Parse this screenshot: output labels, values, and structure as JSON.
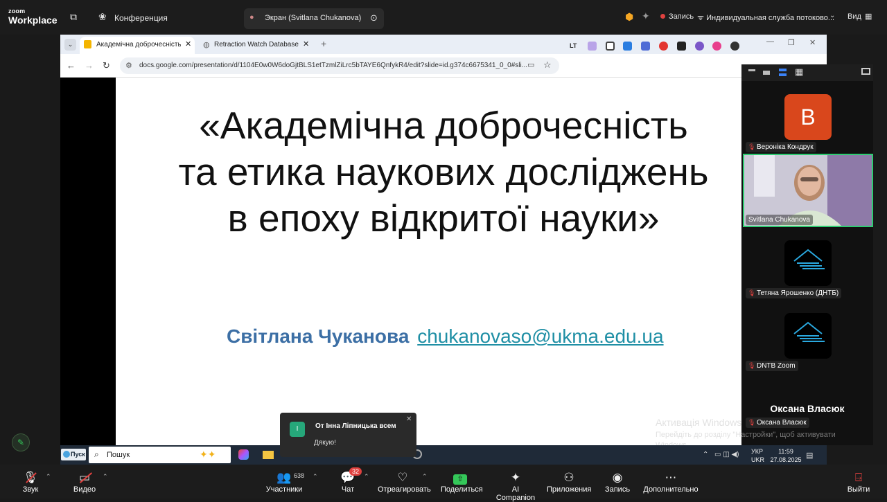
{
  "zoom": {
    "brand_small": "zoom",
    "brand_big": "Workplace",
    "meeting_label": "Конференция",
    "screen_tab_label": "Экран (Svitlana Chukanova)",
    "record_label": "Запись",
    "stream_label": "Индивидуальная служба потоково...",
    "view_label": "Вид"
  },
  "browser": {
    "tabs": [
      {
        "label": "Академічна доброчесність та і"
      },
      {
        "label": "Retraction Watch Database"
      }
    ],
    "url": "docs.google.com/presentation/d/1104E0w0W6doGjtBLS1etTzmlZiLrc5bTAYE6QnfykR4/edit?slide=id.g374c6675341_0_0#sli..."
  },
  "slide": {
    "title_line1": "«Академічна доброчесність",
    "title_line2": "та етика наукових досліджень",
    "title_line3": "в епоху відкритої науки»",
    "author_name": "Світлана Чуканова",
    "author_email": "chukanovaso@ukma.edu.ua"
  },
  "participants": [
    {
      "name": "Вероніка Кондрук",
      "initial": "В",
      "color": "#d9471c"
    },
    {
      "name": "Svitlana Chukanova"
    },
    {
      "name": "Тетяна Ярошенко (ДНТБ)"
    },
    {
      "name": "DNTB Zoom"
    },
    {
      "name": "Оксана Власюк",
      "display": "Оксана Власюк"
    }
  ],
  "notification": {
    "avatar": "І",
    "title": "От Інна Ліпницька всем",
    "message": "Дякую!"
  },
  "watermark": {
    "title": "Активація Windows",
    "line1": "Перейдіть до розділу \"Настройки\", щоб активувати",
    "line2": "Windows."
  },
  "taskbar": {
    "start": "Пуск",
    "search": "Пошук",
    "lang": "УКР",
    "lang2": "UKR",
    "time": "11:59",
    "date": "27.08.2025"
  },
  "controls": {
    "audio": "Звук",
    "video": "Видео",
    "participants": "Участники",
    "participants_count": "638",
    "chat": "Чат",
    "chat_badge": "32",
    "react": "Отреагировать",
    "share": "Поделиться",
    "ai": "AI Companion",
    "apps": "Приложения",
    "record": "Запись",
    "more": "Дополнительно",
    "leave": "Выйти"
  }
}
